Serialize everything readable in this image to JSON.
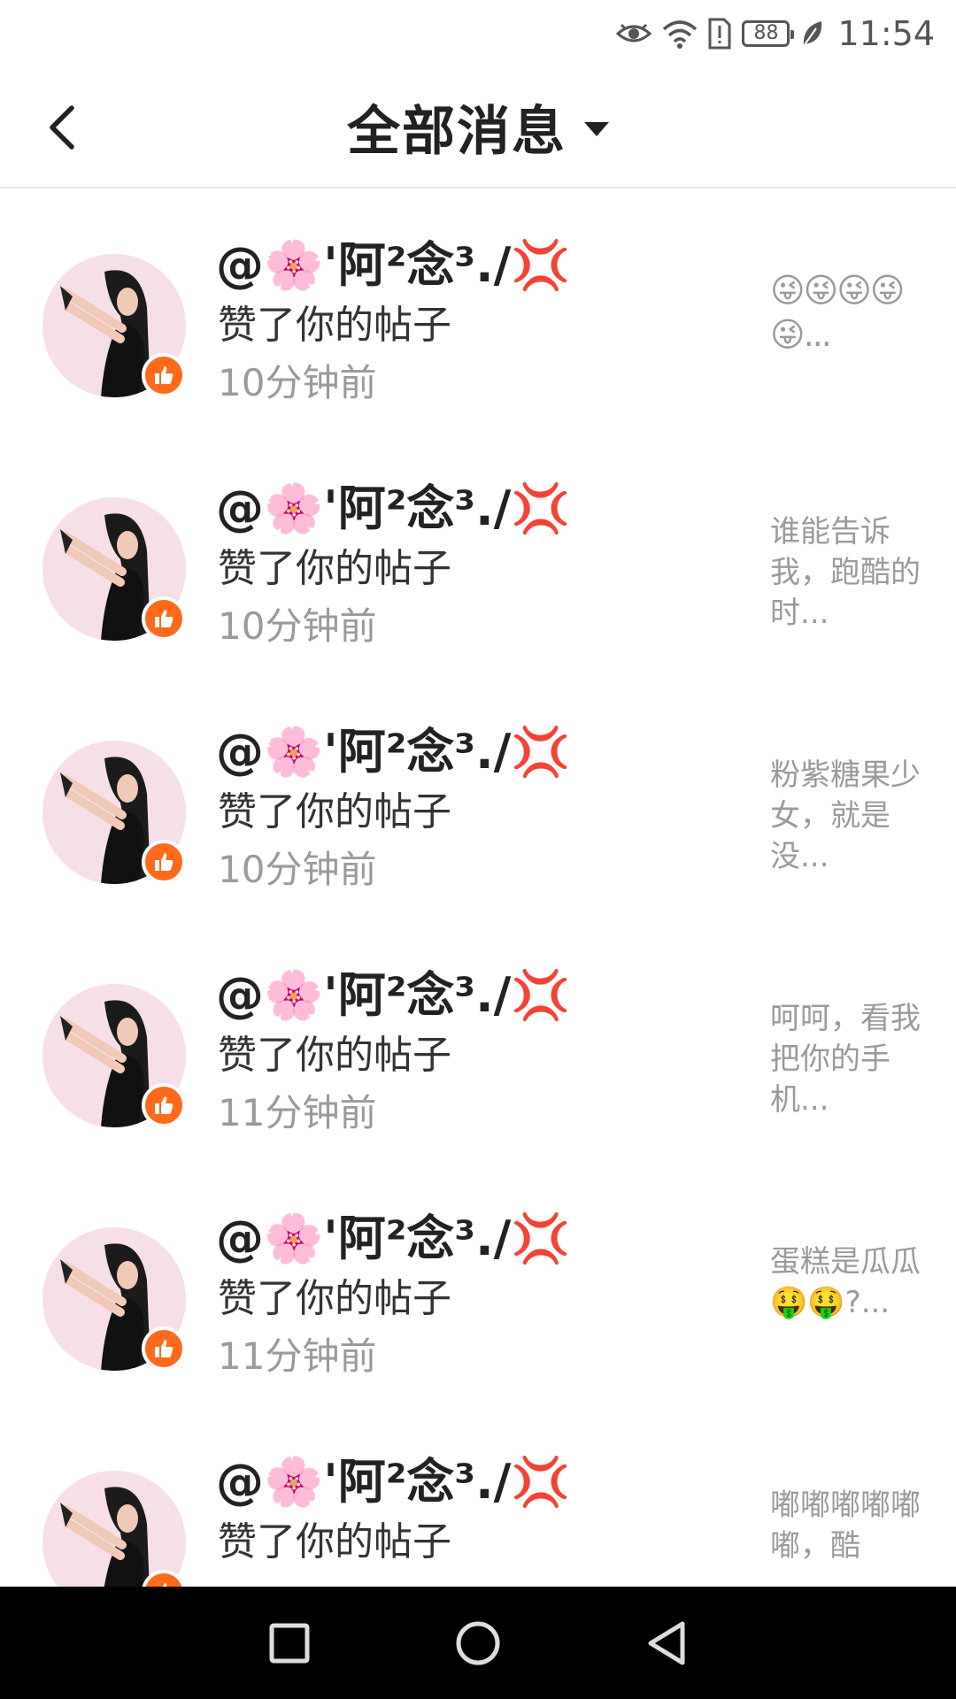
{
  "status_bar": {
    "battery": "88",
    "time": "11:54",
    "icons": [
      "eye-icon",
      "wifi-icon",
      "sim-alert-icon",
      "battery-icon",
      "leaf-icon"
    ]
  },
  "header": {
    "title": "全部消息",
    "back_icon": "chevron-left-icon",
    "dropdown_icon": "caret-down-icon"
  },
  "list": {
    "cut_off_text": "··· ···",
    "items": [
      {
        "nickname_prefix": "@🌸'阿²念³./",
        "nickname_suffix": "💢",
        "action": "赞了你的帖子",
        "time": "10分钟前",
        "preview": "😜😜😜😜😜...",
        "preview_is_emoji": true
      },
      {
        "nickname_prefix": "@🌸'阿²念³./",
        "nickname_suffix": "💢",
        "action": "赞了你的帖子",
        "time": "10分钟前",
        "preview": "谁能告诉我，跑酷的时...",
        "preview_is_emoji": false
      },
      {
        "nickname_prefix": "@🌸'阿²念³./",
        "nickname_suffix": "💢",
        "action": "赞了你的帖子",
        "time": "10分钟前",
        "preview": "粉紫糖果少女，就是没...",
        "preview_is_emoji": false
      },
      {
        "nickname_prefix": "@🌸'阿²念³./",
        "nickname_suffix": "💢",
        "action": "赞了你的帖子",
        "time": "11分钟前",
        "preview": "呵呵，看我把你的手机...",
        "preview_is_emoji": false
      },
      {
        "nickname_prefix": "@🌸'阿²念³./",
        "nickname_suffix": "💢",
        "action": "赞了你的帖子",
        "time": "11分钟前",
        "preview": "蛋糕是瓜瓜🤑🤑?...",
        "preview_is_emoji": false
      },
      {
        "nickname_prefix": "@🌸'阿²念³./",
        "nickname_suffix": "💢",
        "action": "赞了你的帖子",
        "time": "",
        "preview": "嘟嘟嘟嘟嘟嘟，酷",
        "preview_is_emoji": false
      }
    ]
  },
  "nav_bar": {
    "buttons": [
      "recents-square-icon",
      "home-circle-icon",
      "back-triangle-icon"
    ]
  }
}
